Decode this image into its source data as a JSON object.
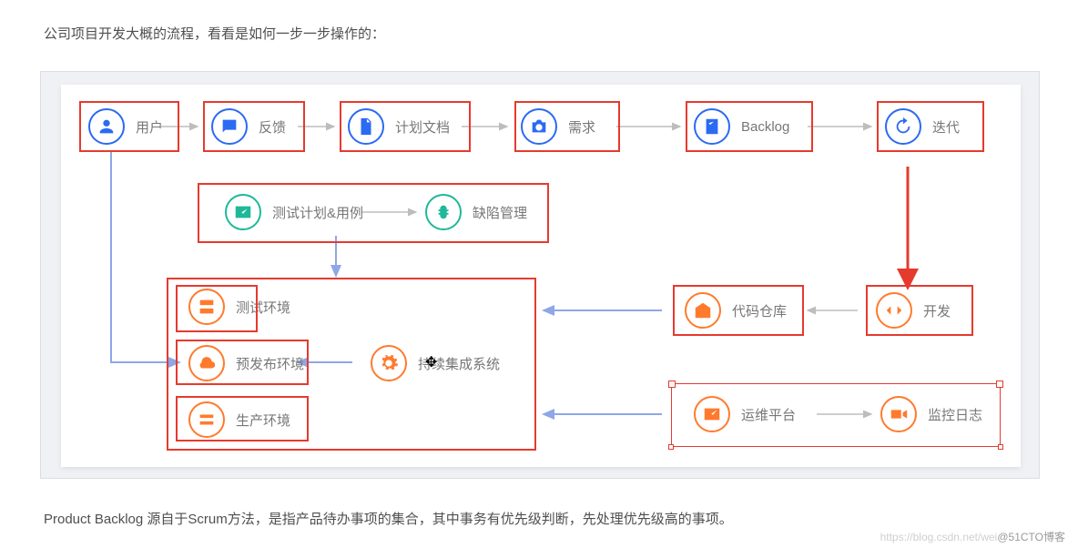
{
  "paragraph_top": "公司项目开发大概的流程，看看是如何一步一步操作的：",
  "paragraph_bottom": "Product Backlog 源自于Scrum方法，是指产品待办事项的集合，其中事务有优先级判断，先处理优先级高的事项。",
  "watermark_faint": "https://blog.csdn.net/wei",
  "watermark_bold": "@51CTO博客",
  "row1": {
    "n1": "用户",
    "n2": "反馈",
    "n3": "计划文档",
    "n4": "需求",
    "n5": "Backlog",
    "n6": "迭代"
  },
  "row2": {
    "n1": "测试计划&用例",
    "n2": "缺陷管理"
  },
  "row3": {
    "n1": "代码仓库",
    "n2": "开发"
  },
  "row4": {
    "n1": "测试环境",
    "n2": "预发布环境",
    "n3": "生产环境",
    "n4": "持续集成系统"
  },
  "row5": {
    "n1": "运维平台",
    "n2": "监控日志"
  }
}
